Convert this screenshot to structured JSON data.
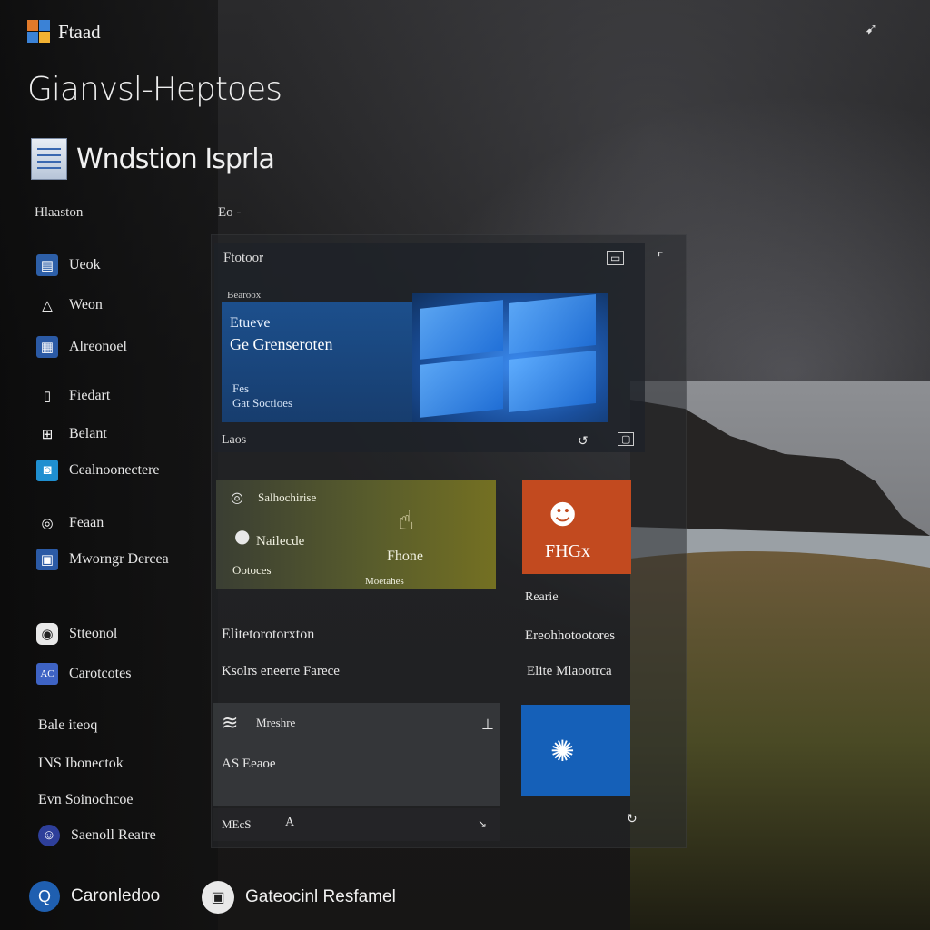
{
  "app": {
    "title": "Ftaad",
    "heading": "Gianvsl-Heptoes",
    "subheading": "Wndstion Isprla"
  },
  "sidebar": {
    "header": "Hlaaston",
    "items": [
      {
        "label": "Ueok",
        "icon": "document-grid-icon"
      },
      {
        "label": "Weon",
        "icon": "triangle-up-icon"
      },
      {
        "label": "Alreonoel",
        "icon": "calendar-icon"
      },
      {
        "label": "Fiedart",
        "icon": "clipboard-icon"
      },
      {
        "label": "Belant",
        "icon": "grid-icon"
      },
      {
        "label": "Cealnoonectere",
        "icon": "bluebox-icon"
      },
      {
        "label": "Feaan",
        "icon": "ring-icon"
      },
      {
        "label": "Mworngr Dercea",
        "icon": "screen-icon"
      },
      {
        "label": "Stteonol",
        "icon": "camera-icon"
      },
      {
        "label": "Carotcotes",
        "icon": "ac-icon"
      }
    ],
    "lower": [
      {
        "label": "Bale iteoq"
      },
      {
        "label": "INS Ibonectok"
      },
      {
        "label": "Evn Soinochcoe"
      },
      {
        "label": "Saenoll Reatre",
        "icon": "face-badge-icon"
      }
    ]
  },
  "tiles_header": "Eo -",
  "hero": {
    "title": "Ftotoor",
    "mini_label": "Bearoox",
    "line1": "Etueve",
    "line2": "Ge Grenseroten",
    "line3": "Fes",
    "line4": "Gat Soctioes",
    "footer": "Laos"
  },
  "olive_tile": {
    "top_label": "Salhochirise",
    "mid_label": "Nailecde",
    "bottom_label": "Ootoces",
    "center_label": "Fhone",
    "footer": "Moetahes"
  },
  "orange_tile": {
    "label": "FHGx",
    "caption": "Rearie"
  },
  "rows": {
    "left_title": "Elitetorotorxton",
    "left_sub": "Ksolrs eneerte Farece",
    "right_title": "Ereohhotootores",
    "right_sub": "Elite Mlaootrca"
  },
  "dark_card": {
    "top_label": "Mreshre",
    "mid_label": "AS Eeaoe",
    "foot_label": "MEcS",
    "foot_mark": "A"
  },
  "taskbar": [
    {
      "label": "Caronledoo",
      "icon": "search-q-icon"
    },
    {
      "label": "Gateocinl Resfamel",
      "icon": "app-badge-icon"
    }
  ],
  "colors": {
    "accent_blue": "#1560b8",
    "orange": "#c24a1f",
    "olive": "#5c5c28"
  }
}
